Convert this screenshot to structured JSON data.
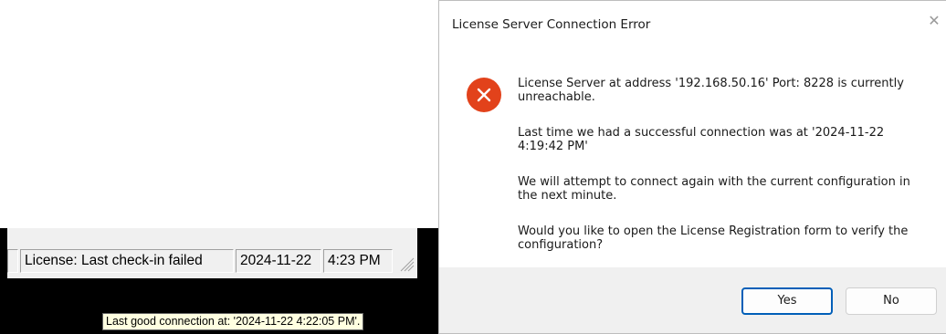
{
  "statusbar": {
    "license_status": "License: Last check-in failed",
    "date": "2024-11-22",
    "time": "4:23 PM"
  },
  "tooltip": {
    "text": "Last good connection at: '2024-11-22 4:22:05 PM'."
  },
  "dialog": {
    "title": "License Server Connection Error",
    "icon": "error-icon",
    "messages": [
      "License Server at address '192.168.50.16' Port: 8228 is currently unreachable.",
      "Last time we had a successful connection was at '2024-11-22 4:19:42 PM'",
      "We will attempt to connect again with the current configuration in the next minute.",
      "Would you like to open the License Registration form to verify the configuration?"
    ],
    "yes_label": "Yes",
    "no_label": "No",
    "accent_color": "#005fb8",
    "error_color": "#e2421b"
  }
}
